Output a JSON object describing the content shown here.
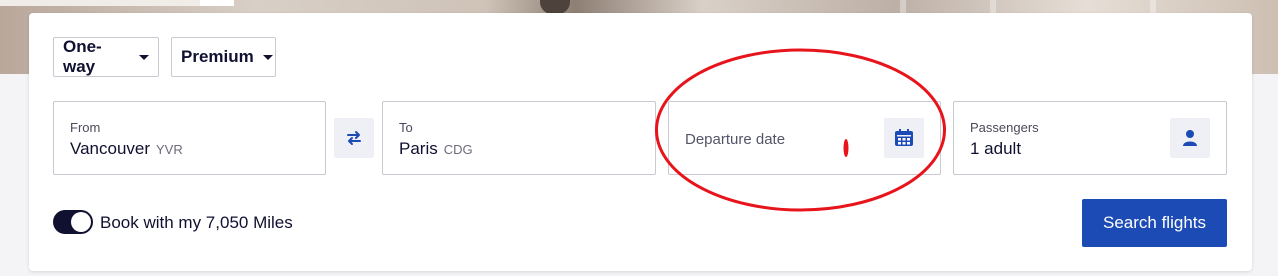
{
  "search": {
    "trip_type": "One-way",
    "cabin": "Premium",
    "from": {
      "label": "From",
      "city": "Vancouver",
      "code": "YVR"
    },
    "to": {
      "label": "To",
      "city": "Paris",
      "code": "CDG"
    },
    "departure": {
      "placeholder": "Departure date"
    },
    "passengers": {
      "label": "Passengers",
      "value": "1 adult"
    },
    "miles_toggle_label": "Book with my 7,050 Miles",
    "miles_toggle_on": true,
    "submit_label": "Search flights"
  },
  "icons": {
    "swap": "swap-arrows-icon",
    "calendar": "calendar-icon",
    "passenger": "person-icon"
  },
  "colors": {
    "primary": "#1c4bb5",
    "text_dark": "#101030",
    "icon_bg": "#eef0f6",
    "annotation": "#e8141c"
  }
}
